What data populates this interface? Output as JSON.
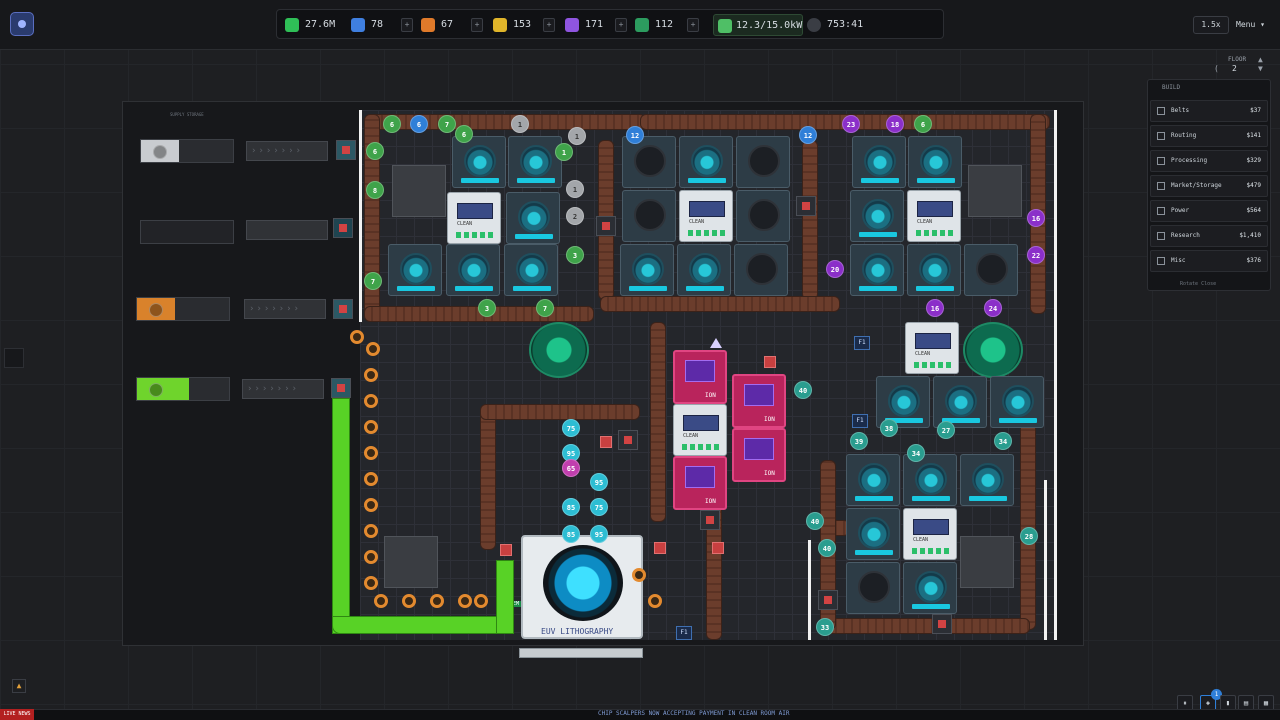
{
  "topbar": {
    "resources": [
      {
        "name": "money",
        "value": "27.6M",
        "color": "#2fbf57"
      },
      {
        "name": "blue",
        "value": "78",
        "color": "#3f7fe0"
      },
      {
        "name": "orange",
        "value": "67",
        "color": "#e07a2a"
      },
      {
        "name": "yellow",
        "value": "153",
        "color": "#e0b52a"
      },
      {
        "name": "purple",
        "value": "171",
        "color": "#8f55e0"
      },
      {
        "name": "green-flask",
        "value": "112",
        "color": "#2c9c5f"
      }
    ],
    "power": "12.3/15.0kW",
    "timer": "753:41",
    "speed": "1.5x",
    "menu": "Menu"
  },
  "floor_selector": {
    "label": "FLOOR",
    "value": "2"
  },
  "supply_storage": {
    "label": "SUPPLY STORAGE"
  },
  "build_panel": {
    "title": "BUILD",
    "items": [
      {
        "label": "Belts",
        "price": "$37"
      },
      {
        "label": "Routing",
        "price": "$141"
      },
      {
        "label": "Processing",
        "price": "$329"
      },
      {
        "label": "Market/Storage",
        "price": "$479"
      },
      {
        "label": "Power",
        "price": "$564"
      },
      {
        "label": "Research",
        "price": "$1,410"
      },
      {
        "label": "Misc",
        "price": "$376"
      }
    ],
    "hint": "Rotate   Close"
  },
  "machines": {
    "clean_label": "CLEAN",
    "ion_label": "ION",
    "euv_label": "EUV LITHOGRAPHY",
    "chem_label": "CHEM",
    "f1_label": "F1"
  },
  "nodes_top": [
    "6",
    "6",
    "7",
    "6",
    "1",
    "1",
    "12",
    "12",
    "23",
    "18",
    "6",
    "6",
    "8",
    "7",
    "3",
    "7",
    "16",
    "22",
    "20",
    "16",
    "24",
    "2",
    "1",
    "3",
    "1",
    "1"
  ],
  "nodes_cyan": [
    "75",
    "95",
    "65",
    "95",
    "85",
    "75",
    "85",
    "95",
    "40",
    "38",
    "27",
    "34",
    "39",
    "34",
    "40",
    "40",
    "28",
    "33"
  ],
  "news": {
    "tag": "LIVE NEWS",
    "text": "CHIP SCALPERS NOW ACCEPTING PAYMENT IN CLEAN ROOM AIR"
  },
  "bottom_controls": {
    "notifications": "1"
  }
}
